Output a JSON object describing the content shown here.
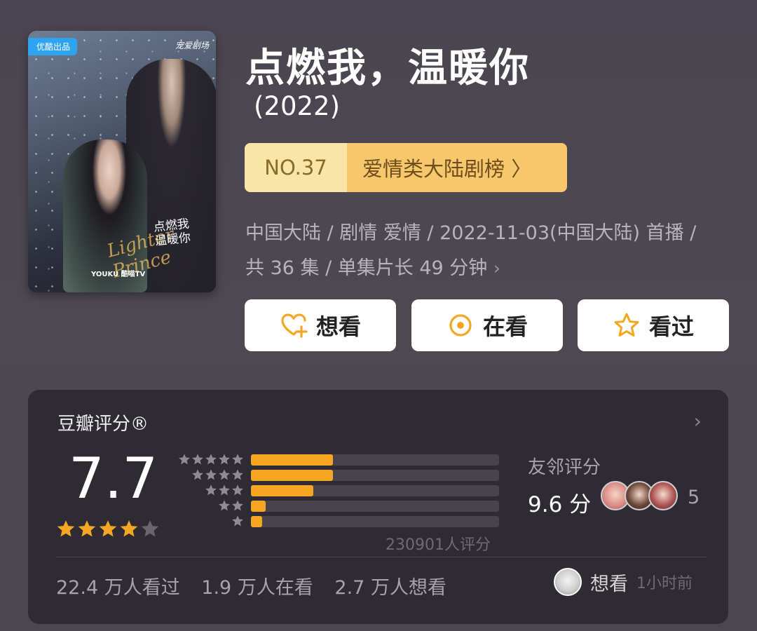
{
  "poster": {
    "badge": "优酷出品",
    "brand": "宠爱剧场",
    "title_line1": "点燃我",
    "title_line2": "温暖你",
    "en_title": "Lighter Prince",
    "logos": "YOUKU  酷喵TV"
  },
  "title": "点燃我，温暖你",
  "year": "(2022)",
  "rank": {
    "number": "NO.37",
    "name": "爱情类大陆剧榜 〉"
  },
  "meta": {
    "line1": "中国大陆 / 剧情 爱情 / 2022-11-03(中国大陆) 首播 /",
    "line2": "共 36 集 / 单集片长 49 分钟",
    "chevron": "›"
  },
  "actions": {
    "want": "想看",
    "doing": "在看",
    "done": "看过"
  },
  "rating": {
    "title": "豆瓣评分®",
    "chevron": "›",
    "score": "7.7",
    "stars_filled": 4,
    "stars_total": 5,
    "distribution": [
      {
        "stars": 5,
        "fraction": 0.33
      },
      {
        "stars": 4,
        "fraction": 0.33
      },
      {
        "stars": 3,
        "fraction": 0.25
      },
      {
        "stars": 2,
        "fraction": 0.06
      },
      {
        "stars": 1,
        "fraction": 0.045
      }
    ],
    "count": "230901人评分",
    "friend_title": "友邻评分",
    "friend_score": "9.6 分",
    "friend_count": "5",
    "stats": [
      "22.4 万人看过",
      "1.9 万人在看",
      "2.7 万人想看"
    ],
    "activity_action": "想看",
    "activity_time": "1小时前"
  },
  "colors": {
    "accent": "#f5a623",
    "background": "#4b4650",
    "card": "#2f2b33"
  }
}
